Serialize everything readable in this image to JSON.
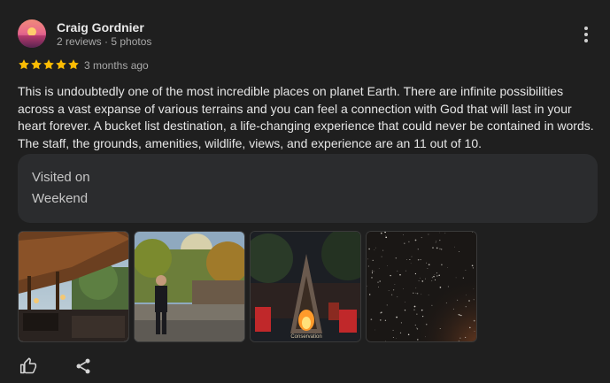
{
  "author": {
    "name": "Craig Gordnier",
    "meta": "2 reviews · 5 photos",
    "avatar_icon": "sunset-avatar"
  },
  "rating": {
    "value": 5,
    "max": 5,
    "color": "#fbbc04"
  },
  "date": "3 months ago",
  "review_text": "This is undoubtedly one of the most incredible places on planet Earth. There are infinite possibilities across a vast expanse of various terrains and you can feel a connection with God that will last in your heart forever. A bucket list destination, a life-changing experience that could never be contained in words. The staff, the grounds, amenities, wildlife, views, and experience are an 11 out of 10.",
  "visited": {
    "label": "Visited on",
    "value": "Weekend"
  },
  "photos": [
    {
      "icon": "pavilion-photo"
    },
    {
      "icon": "person-deck-photo"
    },
    {
      "icon": "fire-pit-photo",
      "caption": "Conservation"
    },
    {
      "icon": "starry-sky-photo"
    }
  ],
  "actions": {
    "like_icon": "thumbs-up-icon",
    "share_icon": "share-icon"
  },
  "colors": {
    "background": "#1f1f1f",
    "card": "#2b2c2e",
    "star": "#fbbc04"
  }
}
